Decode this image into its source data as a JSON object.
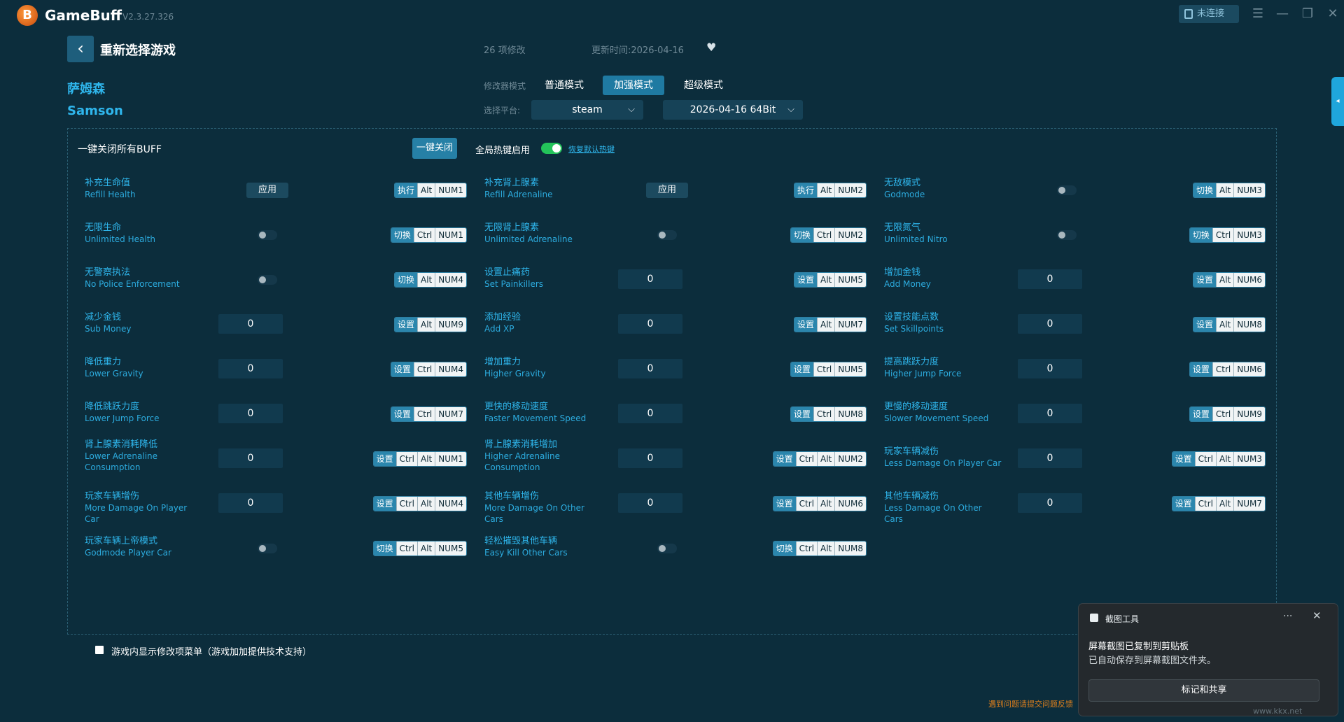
{
  "titlebar": {
    "app_name": "GameBuff",
    "version": "V2.3.27.326",
    "connection": "未连接",
    "logo_glyph": "B"
  },
  "header": {
    "back_label": "重新选择游戏",
    "mod_count": "26 项修改",
    "update_time": "更新时间:2026-04-16",
    "game_name_cn": "萨姆森",
    "game_name_en": "Samson",
    "mode_label": "修改器模式",
    "modes": [
      "普通模式",
      "加强模式",
      "超级模式"
    ],
    "active_mode": "加强模式",
    "platform_label": "选择平台:",
    "platform": "steam",
    "version_select": "2026-04-16 64Bit"
  },
  "panel": {
    "close_all_label": "一键关闭所有BUFF",
    "close_all_button": "一键关闭",
    "hotkey_label": "全局热键启用",
    "hotkey_enabled": true,
    "restore_link": "恢复默认热键"
  },
  "cheats": [
    {
      "cn": "补充生命值",
      "en": "Refill Health",
      "control": "apply",
      "value": "应用",
      "keys": [
        "执行",
        "Alt",
        "NUM1"
      ]
    },
    {
      "cn": "补充肾上腺素",
      "en": "Refill Adrenaline",
      "control": "apply",
      "value": "应用",
      "keys": [
        "执行",
        "Alt",
        "NUM2"
      ]
    },
    {
      "cn": "无敌模式",
      "en": "Godmode",
      "control": "toggle",
      "keys": [
        "切换",
        "Alt",
        "NUM3"
      ]
    },
    {
      "cn": "无限生命",
      "en": "Unlimited Health",
      "control": "toggle",
      "keys": [
        "切换",
        "Ctrl",
        "NUM1"
      ]
    },
    {
      "cn": "无限肾上腺素",
      "en": "Unlimited Adrenaline",
      "control": "toggle",
      "keys": [
        "切换",
        "Ctrl",
        "NUM2"
      ]
    },
    {
      "cn": "无限氮气",
      "en": "Unlimited Nitro",
      "control": "toggle",
      "keys": [
        "切换",
        "Ctrl",
        "NUM3"
      ]
    },
    {
      "cn": "无警察执法",
      "en": "No Police Enforcement",
      "control": "toggle",
      "keys": [
        "切换",
        "Alt",
        "NUM4"
      ]
    },
    {
      "cn": "设置止痛药",
      "en": "Set Painkillers",
      "control": "input",
      "value": "0",
      "keys": [
        "设置",
        "Alt",
        "NUM5"
      ]
    },
    {
      "cn": "增加金钱",
      "en": "Add Money",
      "control": "input",
      "value": "0",
      "keys": [
        "设置",
        "Alt",
        "NUM6"
      ]
    },
    {
      "cn": "减少金钱",
      "en": "Sub Money",
      "control": "input",
      "value": "0",
      "keys": [
        "设置",
        "Alt",
        "NUM9"
      ]
    },
    {
      "cn": "添加经验",
      "en": "Add XP",
      "control": "input",
      "value": "0",
      "keys": [
        "设置",
        "Alt",
        "NUM7"
      ]
    },
    {
      "cn": "设置技能点数",
      "en": "Set Skillpoints",
      "control": "input",
      "value": "0",
      "keys": [
        "设置",
        "Alt",
        "NUM8"
      ]
    },
    {
      "cn": "降低重力",
      "en": "Lower Gravity",
      "control": "input",
      "value": "0",
      "keys": [
        "设置",
        "Ctrl",
        "NUM4"
      ]
    },
    {
      "cn": "增加重力",
      "en": "Higher Gravity",
      "control": "input",
      "value": "0",
      "keys": [
        "设置",
        "Ctrl",
        "NUM5"
      ]
    },
    {
      "cn": "提高跳跃力度",
      "en": "Higher Jump Force",
      "control": "input",
      "value": "0",
      "keys": [
        "设置",
        "Ctrl",
        "NUM6"
      ]
    },
    {
      "cn": "降低跳跃力度",
      "en": "Lower Jump Force",
      "control": "input",
      "value": "0",
      "keys": [
        "设置",
        "Ctrl",
        "NUM7"
      ]
    },
    {
      "cn": "更快的移动速度",
      "en": "Faster Movement Speed",
      "control": "input",
      "value": "0",
      "keys": [
        "设置",
        "Ctrl",
        "NUM8"
      ]
    },
    {
      "cn": "更慢的移动速度",
      "en": "Slower Movement Speed",
      "control": "input",
      "value": "0",
      "keys": [
        "设置",
        "Ctrl",
        "NUM9"
      ]
    },
    {
      "cn": "肾上腺素消耗降低",
      "en": "Lower Adrenaline Consumption",
      "control": "input",
      "value": "0",
      "keys": [
        "设置",
        "Ctrl",
        "Alt",
        "NUM1"
      ]
    },
    {
      "cn": "肾上腺素消耗增加",
      "en": "Higher Adrenaline Consumption",
      "control": "input",
      "value": "0",
      "keys": [
        "设置",
        "Ctrl",
        "Alt",
        "NUM2"
      ]
    },
    {
      "cn": "玩家车辆减伤",
      "en": "Less Damage On Player Car",
      "control": "input",
      "value": "0",
      "keys": [
        "设置",
        "Ctrl",
        "Alt",
        "NUM3"
      ]
    },
    {
      "cn": "玩家车辆增伤",
      "en": "More Damage On Player Car",
      "control": "input",
      "value": "0",
      "keys": [
        "设置",
        "Ctrl",
        "Alt",
        "NUM4"
      ]
    },
    {
      "cn": "其他车辆增伤",
      "en": "More Damage On Other Cars",
      "control": "input",
      "value": "0",
      "keys": [
        "设置",
        "Ctrl",
        "Alt",
        "NUM6"
      ]
    },
    {
      "cn": "其他车辆减伤",
      "en": "Less Damage On Other Cars",
      "control": "input",
      "value": "0",
      "keys": [
        "设置",
        "Ctrl",
        "Alt",
        "NUM7"
      ]
    },
    {
      "cn": "玩家车辆上帝模式",
      "en": "Godmode Player Car",
      "control": "toggle",
      "keys": [
        "切换",
        "Ctrl",
        "Alt",
        "NUM5"
      ]
    },
    {
      "cn": "轻松摧毁其他车辆",
      "en": "Easy Kill Other Cars",
      "control": "toggle",
      "keys": [
        "切换",
        "Ctrl",
        "Alt",
        "NUM8"
      ]
    }
  ],
  "footer": {
    "ingame_menu_label": "游戏内显示修改项菜单（游戏加加提供技术支持）",
    "feedback": "遇到问题请提交问题反馈"
  },
  "toast": {
    "title": "截图工具",
    "line1": "屏幕截图已复制到剪贴板",
    "line2": "已自动保存到屏幕截图文件夹。",
    "button": "标记和共享",
    "more": "···",
    "close": "✕"
  },
  "watermark": "www.kkx.net",
  "colors": {
    "background": "#0c2d3c",
    "accent": "#2fb6ec",
    "active_mode": "#1f7aa2",
    "toggle_on": "#23c35a"
  }
}
